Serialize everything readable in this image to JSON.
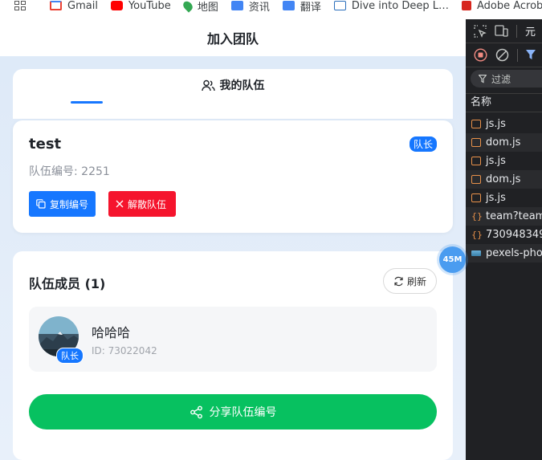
{
  "bookmarks": [
    {
      "label": "Gmail",
      "icon": "gmail-icon",
      "color": "#ea4335"
    },
    {
      "label": "YouTube",
      "icon": "youtube-icon",
      "color": "#ff0000"
    },
    {
      "label": "地图",
      "icon": "maps-icon",
      "color": "#34a853"
    },
    {
      "label": "资讯",
      "icon": "news-icon",
      "color": "#4285f4"
    },
    {
      "label": "翻译",
      "icon": "translate-icon",
      "color": "#4285f4"
    },
    {
      "label": "Dive into Deep L…",
      "icon": "d2l-icon",
      "color": "#2a6ebb"
    },
    {
      "label": "Adobe Acrob",
      "icon": "acrobat-icon",
      "color": "#d7261e"
    }
  ],
  "app": {
    "title": "加入团队",
    "tab_my_team": "我的队伍",
    "team": {
      "name": "test",
      "role_badge": "队长",
      "number_label": "队伍编号: 2251",
      "copy_button": "复制编号",
      "dissolve_button": "解散队伍"
    },
    "members": {
      "title": "队伍成员 (1)",
      "refresh_button": "刷新",
      "list": [
        {
          "name": "哈哈哈",
          "id_label": "ID: 73022042",
          "badge": "队长"
        }
      ]
    },
    "share_button": "分享队伍编号",
    "float_badge": "45M"
  },
  "devtools": {
    "panel_label": "元",
    "filter_placeholder": "过滤",
    "column_name": "名称",
    "requests": [
      {
        "name": "js.js",
        "type": "script"
      },
      {
        "name": "dom.js",
        "type": "script"
      },
      {
        "name": "js.js",
        "type": "script"
      },
      {
        "name": "dom.js",
        "type": "script"
      },
      {
        "name": "js.js",
        "type": "script"
      },
      {
        "name": "team?team",
        "type": "fetch"
      },
      {
        "name": "730948349",
        "type": "fetch"
      },
      {
        "name": "pexels-pho",
        "type": "image"
      }
    ]
  },
  "colors": {
    "primary": "#1677ff",
    "danger": "#f5142d",
    "success": "#07c160"
  }
}
